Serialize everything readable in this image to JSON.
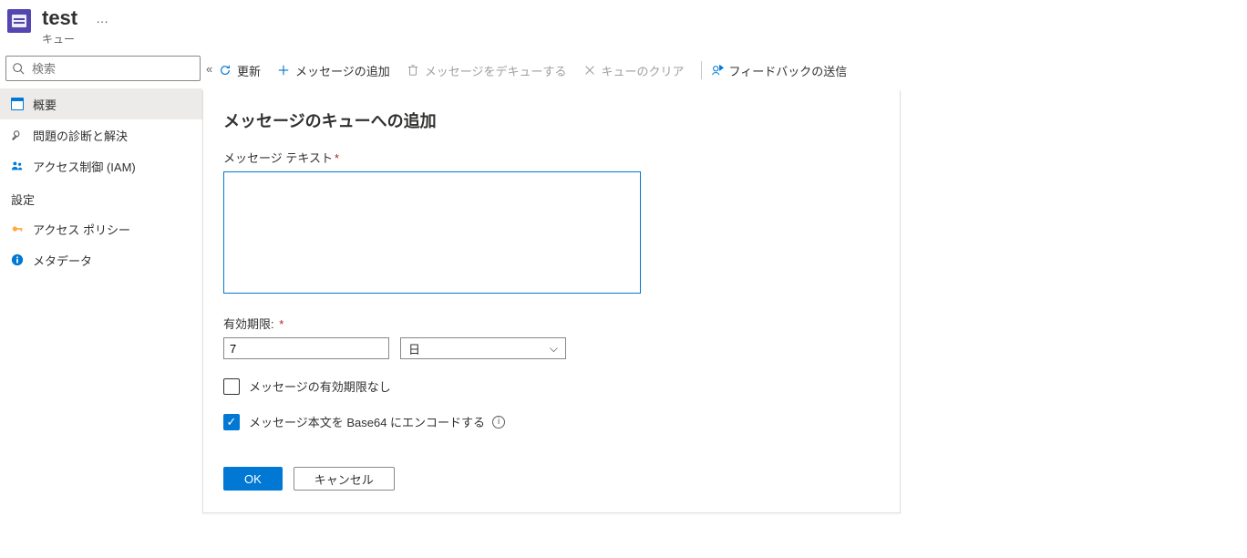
{
  "header": {
    "title": "test",
    "subtitle": "キュー",
    "more": "…"
  },
  "search": {
    "placeholder": "検索"
  },
  "nav": {
    "items": [
      {
        "icon": "window",
        "label": "概要"
      },
      {
        "icon": "wrench",
        "label": "問題の診断と解決"
      },
      {
        "icon": "people",
        "label": "アクセス制御 (IAM)"
      }
    ],
    "section_settings": "設定",
    "settings_items": [
      {
        "icon": "key",
        "label": "アクセス ポリシー"
      },
      {
        "icon": "info",
        "label": "メタデータ"
      }
    ]
  },
  "toolbar": {
    "refresh": "更新",
    "add_message": "メッセージの追加",
    "dequeue": "メッセージをデキューする",
    "clear_queue": "キューのクリア",
    "feedback": "フィードバックの送信"
  },
  "panel": {
    "title": "メッセージのキューへの追加",
    "message_text_label": "メッセージ テキスト",
    "expiry_label": "有効期限:",
    "expiry_value": "7",
    "expiry_unit": "日",
    "no_expiry_label": "メッセージの有効期限なし",
    "base64_label": "メッセージ本文を Base64 にエンコードする",
    "ok": "OK",
    "cancel": "キャンセル"
  }
}
